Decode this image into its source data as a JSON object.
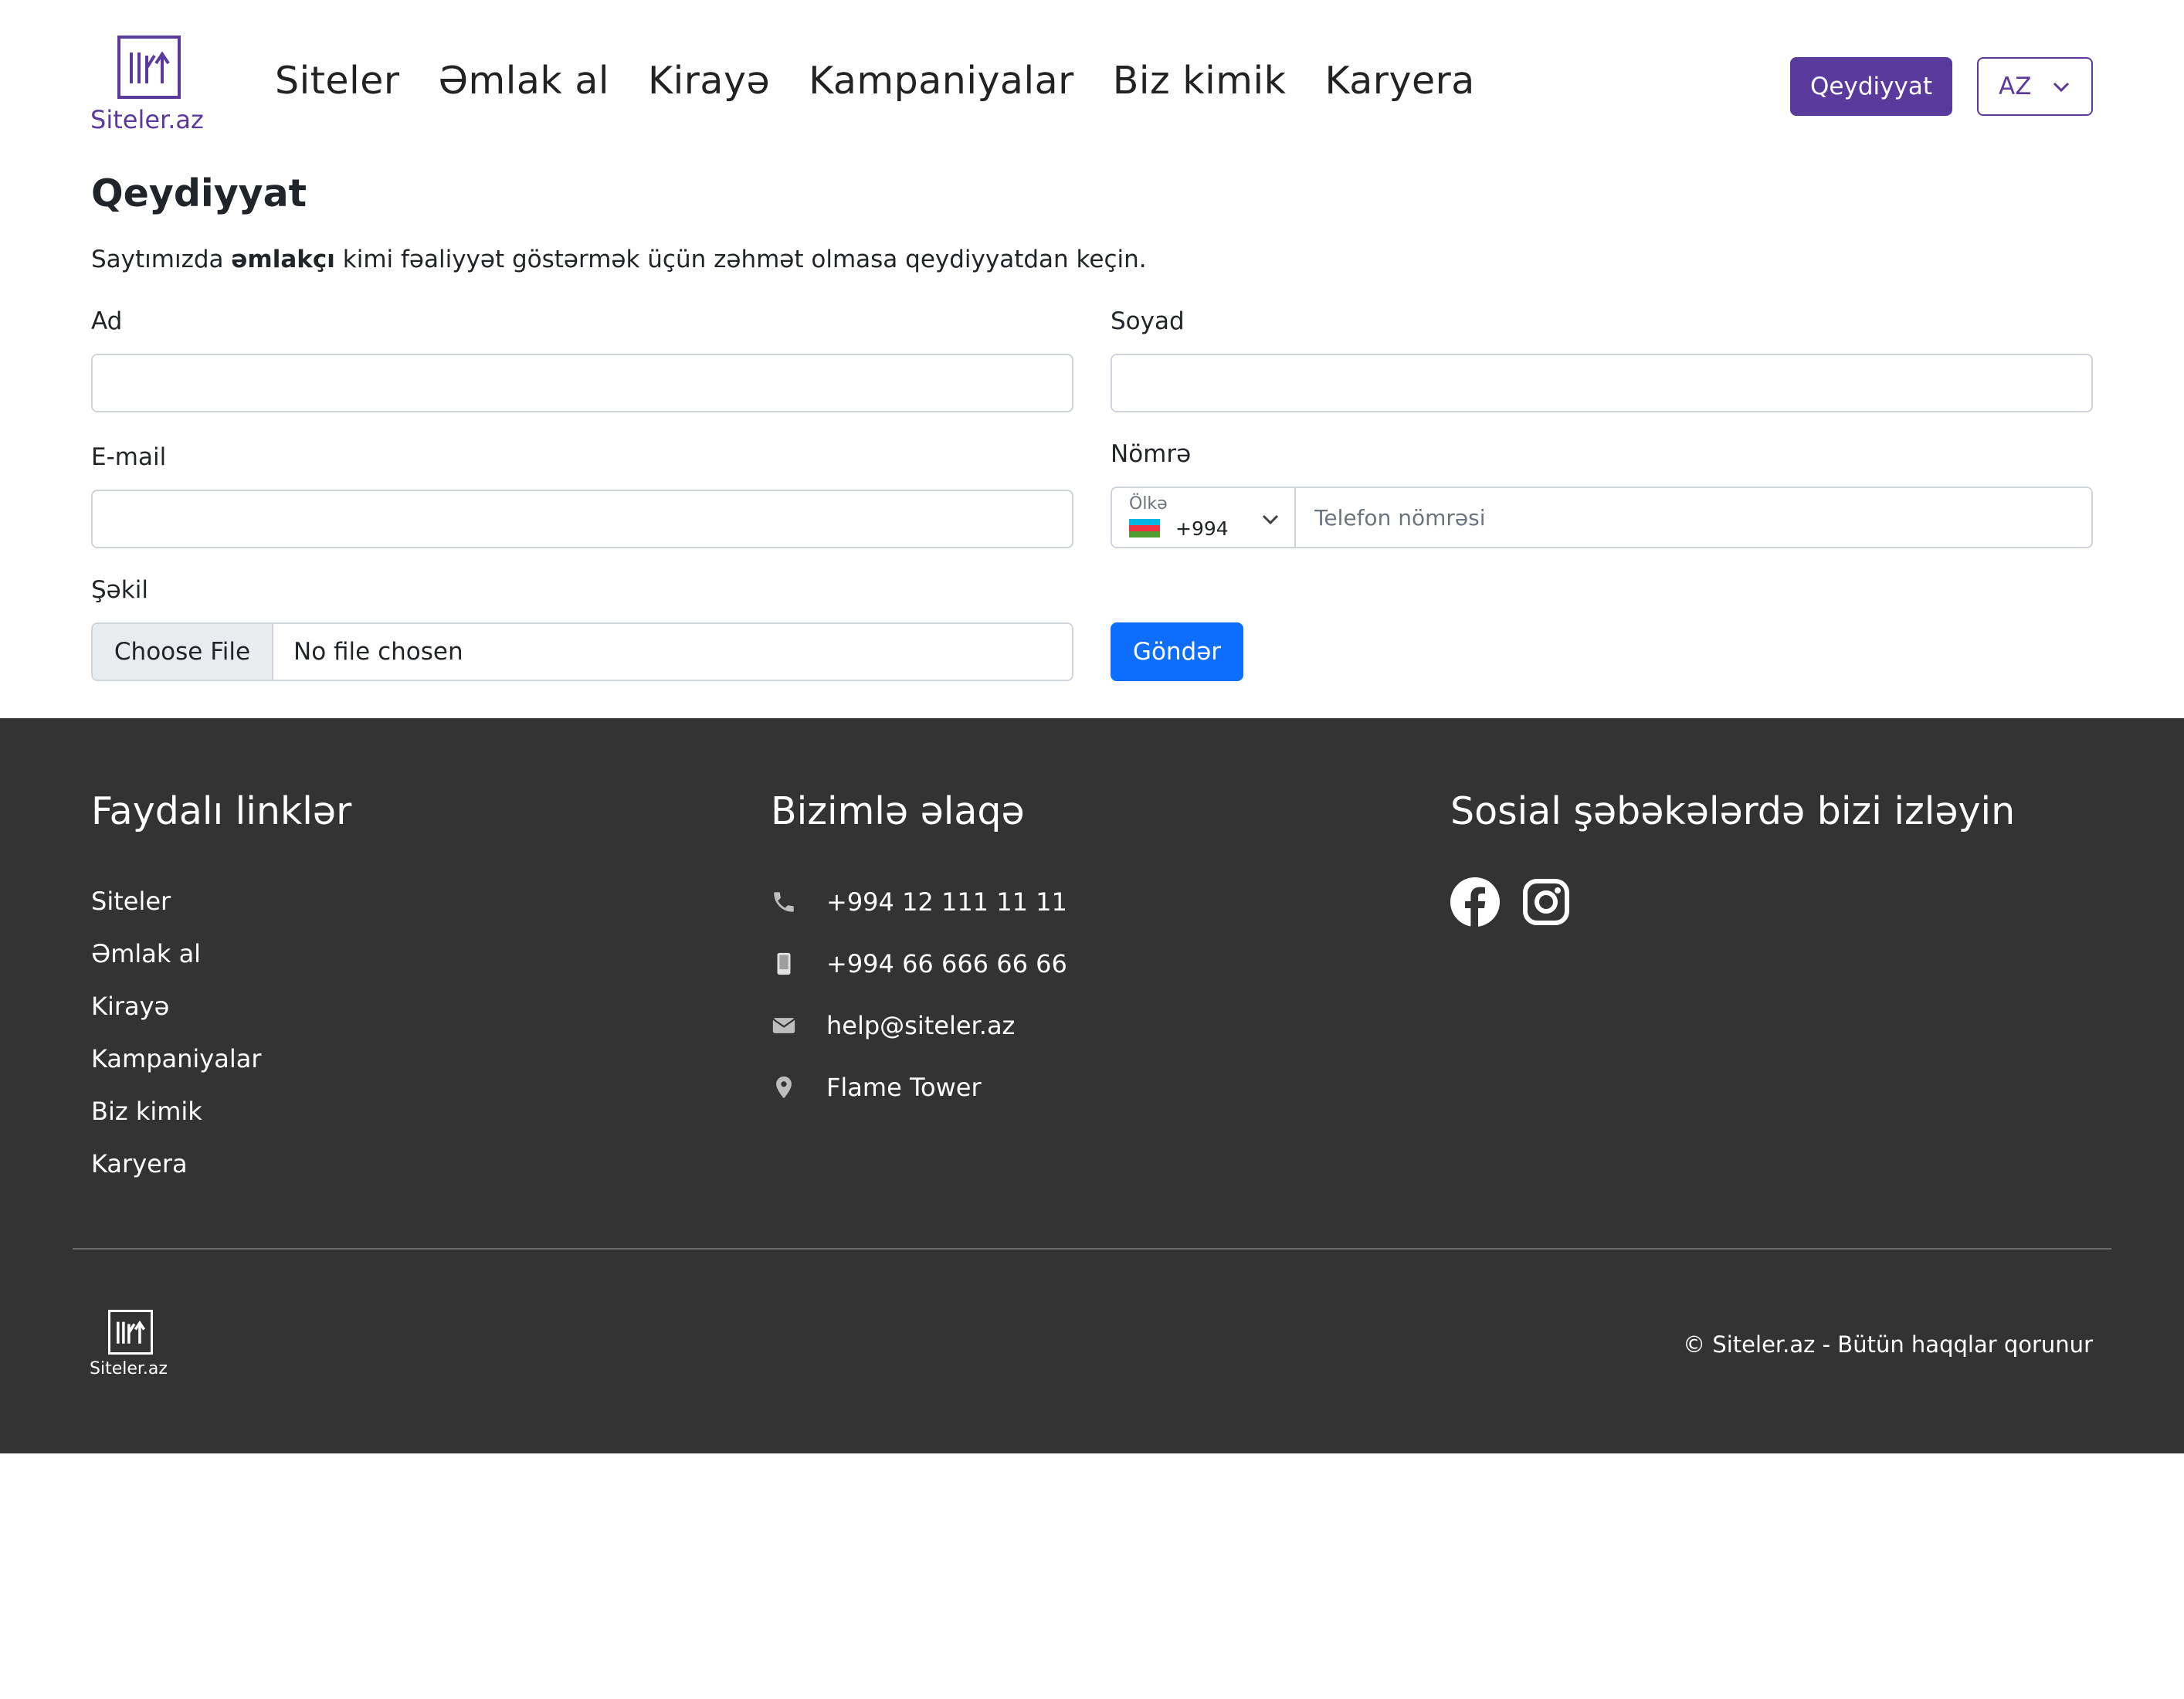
{
  "brand": {
    "name": "Siteler.az",
    "color": "#5b3a9e"
  },
  "nav": {
    "items": [
      "Siteler",
      "Əmlak al",
      "Kirayə",
      "Kampaniyalar",
      "Biz kimik",
      "Karyera"
    ]
  },
  "header": {
    "register_label": "Qeydiyyat",
    "language": "AZ"
  },
  "form": {
    "title": "Qeydiyyat",
    "intro_before": "Saytımızda ",
    "intro_bold": "əmlakçı",
    "intro_after": " kimi fəaliyyət göstərmək üçün zəhmət olmasa qeydiyyatdan keçin.",
    "first_name_label": "Ad",
    "first_name_value": "",
    "last_name_label": "Soyad",
    "last_name_value": "",
    "email_label": "E-mail",
    "email_value": "",
    "phone_label": "Nömrə",
    "country_label": "Ölkə",
    "country_code": "+994",
    "phone_placeholder": "Telefon nömrəsi",
    "photo_label": "Şəkil",
    "choose_file_label": "Choose File",
    "file_status": "No file chosen",
    "submit_label": "Göndər"
  },
  "footer": {
    "links_heading": "Faydalı linklər",
    "links": [
      "Siteler",
      "Əmlak al",
      "Kirayə",
      "Kampaniyalar",
      "Biz kimik",
      "Karyera"
    ],
    "contact_heading": "Bizimlə əlaqə",
    "contacts": [
      {
        "icon": "phone-icon",
        "text": "+994 12 111 11 11"
      },
      {
        "icon": "mobile-icon",
        "text": "+994 66 666 66 66"
      },
      {
        "icon": "envelope-icon",
        "text": "help@siteler.az"
      },
      {
        "icon": "map-pin-icon",
        "text": "Flame Tower"
      }
    ],
    "social_heading": "Sosial şəbəkələrdə bizi izləyin",
    "social": [
      "facebook-icon",
      "instagram-icon"
    ],
    "copyright": "© Siteler.az - Bütün haqqlar qorunur",
    "background": "#333333"
  },
  "colors": {
    "primary_button": "#0d6efd",
    "register_button": "#5b3a9e"
  }
}
